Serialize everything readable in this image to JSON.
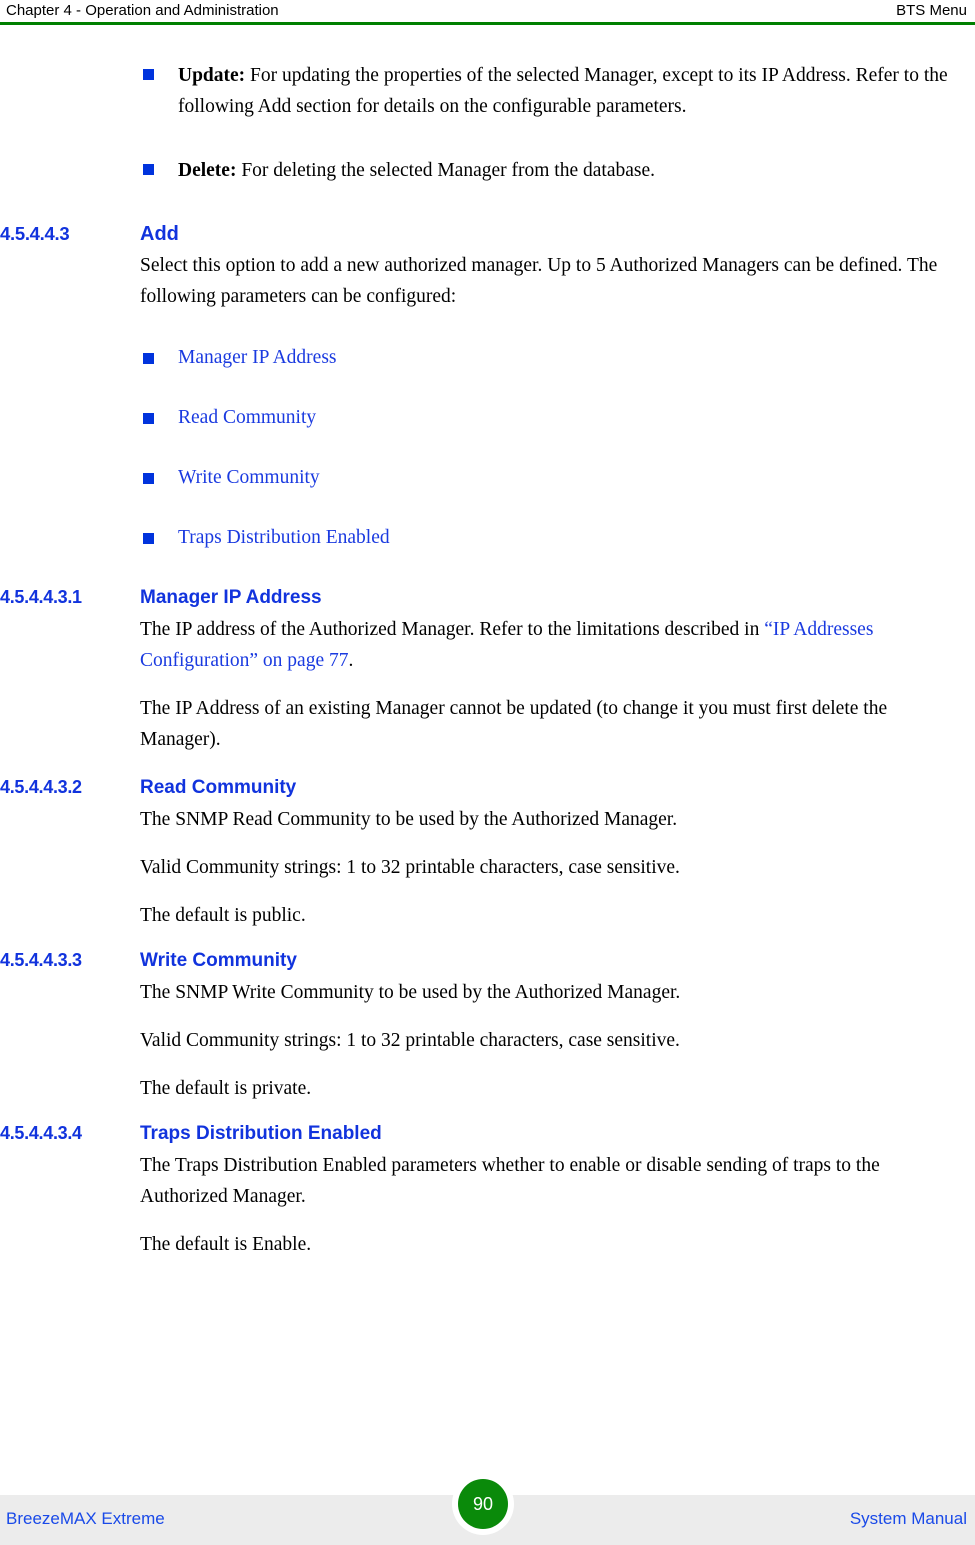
{
  "header": {
    "left": "Chapter 4 - Operation and Administration",
    "right": "BTS Menu",
    "rule_color": "#008000"
  },
  "colors": {
    "heading_blue": "#1133dd",
    "link_blue": "#1a3ae0",
    "bullet_blue": "#0033dd",
    "footer_blue": "#1a4ae8",
    "footer_band": "#ececec",
    "badge_green": "#0a8a0a"
  },
  "top_bullets": [
    {
      "lead": "Update:",
      "text": " For updating the properties of the selected Manager, except to its IP Address. Refer to the following Add section for details on the configurable parameters."
    },
    {
      "lead": "Delete:",
      "text": " For deleting the selected Manager from the database."
    }
  ],
  "sections": [
    {
      "number": "4.5.4.4.3",
      "title": "Add",
      "intro": "Select this option to add a new authorized manager. Up to 5 Authorized Managers can be defined. The following parameters can be configured:",
      "params": [
        "Manager IP Address",
        "Read Community",
        "Write Community",
        "Traps Distribution Enabled"
      ]
    },
    {
      "number": "4.5.4.4.3.1",
      "title": "Manager IP Address",
      "p1_before": "The IP address of the Authorized Manager. Refer to the limitations described in ",
      "p1_link": "“IP Addresses Configuration” on page 77",
      "p1_after": ".",
      "p2": "The IP Address of an existing Manager cannot be updated (to change it you must first delete the Manager)."
    },
    {
      "number": "4.5.4.4.3.2",
      "title": "Read Community",
      "p1": "The SNMP Read Community to be used by the Authorized Manager.",
      "p2": "Valid Community strings: 1 to 32 printable characters, case sensitive.",
      "p3": "The default is public."
    },
    {
      "number": "4.5.4.4.3.3",
      "title": "Write Community",
      "p1": "The SNMP Write Community to be used by the Authorized Manager.",
      "p2": "Valid Community strings: 1 to 32 printable characters, case sensitive.",
      "p3": "The default is private."
    },
    {
      "number": "4.5.4.4.3.4",
      "title": "Traps Distribution Enabled",
      "p1": "The Traps Distribution Enabled parameters whether to enable or disable sending of traps to the Authorized Manager.",
      "p2": "The default is Enable."
    }
  ],
  "footer": {
    "left": "BreezeMAX Extreme",
    "page_number": "90",
    "right": "System Manual"
  }
}
